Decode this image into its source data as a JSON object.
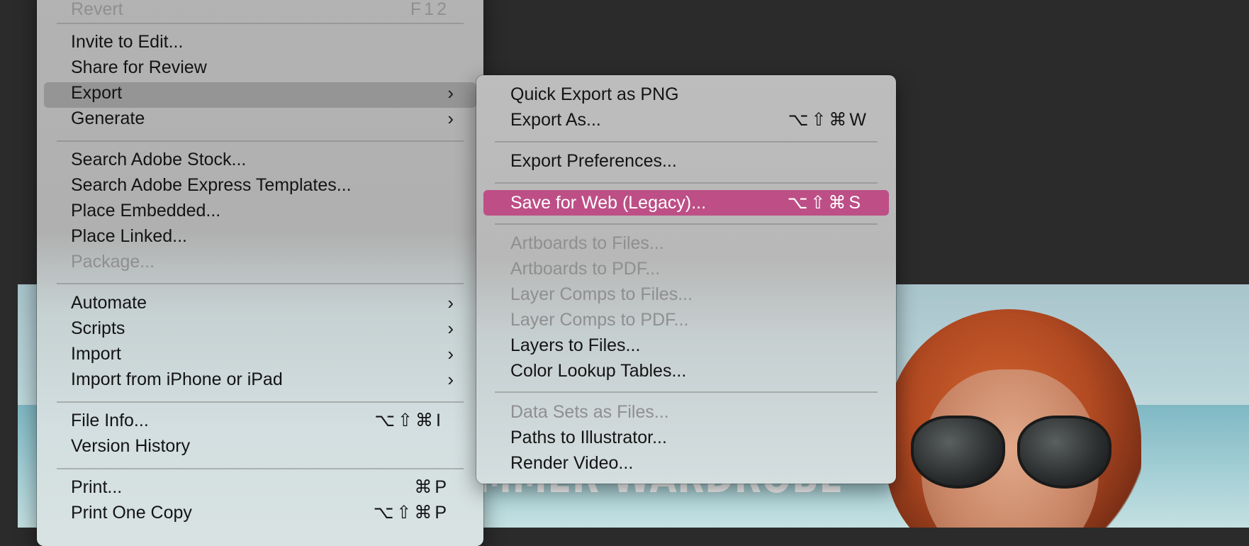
{
  "canvas": {
    "headline": "MMER WARDROBE"
  },
  "main_menu": {
    "revert": {
      "label": "Revert",
      "shortcut": "F12"
    },
    "invite": "Invite to Edit...",
    "share": "Share for Review",
    "export": "Export",
    "generate": "Generate",
    "search_stock": "Search Adobe Stock...",
    "search_express": "Search Adobe Express Templates...",
    "place_embedded": "Place Embedded...",
    "place_linked": "Place Linked...",
    "package": "Package...",
    "automate": "Automate",
    "scripts": "Scripts",
    "import": "Import",
    "import_iphone": "Import from iPhone or iPad",
    "file_info": {
      "label": "File Info...",
      "shortcut": "⌥⇧⌘I"
    },
    "version_history": "Version History",
    "print": {
      "label": "Print...",
      "shortcut": "⌘P"
    },
    "print_one": {
      "label": "Print One Copy",
      "shortcut": "⌥⇧⌘P"
    }
  },
  "export_submenu": {
    "quick_export": "Quick Export as PNG",
    "export_as": {
      "label": "Export As...",
      "shortcut": "⌥⇧⌘W"
    },
    "export_prefs": "Export Preferences...",
    "save_for_web": {
      "label": "Save for Web (Legacy)...",
      "shortcut": "⌥⇧⌘S"
    },
    "artboards_files": "Artboards to Files...",
    "artboards_pdf": "Artboards to PDF...",
    "layer_comps_files": "Layer Comps to Files...",
    "layer_comps_pdf": "Layer Comps to PDF...",
    "layers_files": "Layers to Files...",
    "color_lookup": "Color Lookup Tables...",
    "data_sets": "Data Sets as Files...",
    "paths_illustrator": "Paths to Illustrator...",
    "render_video": "Render Video..."
  },
  "colors": {
    "highlight": "#bd4f86",
    "background": "#2b2b2b"
  }
}
